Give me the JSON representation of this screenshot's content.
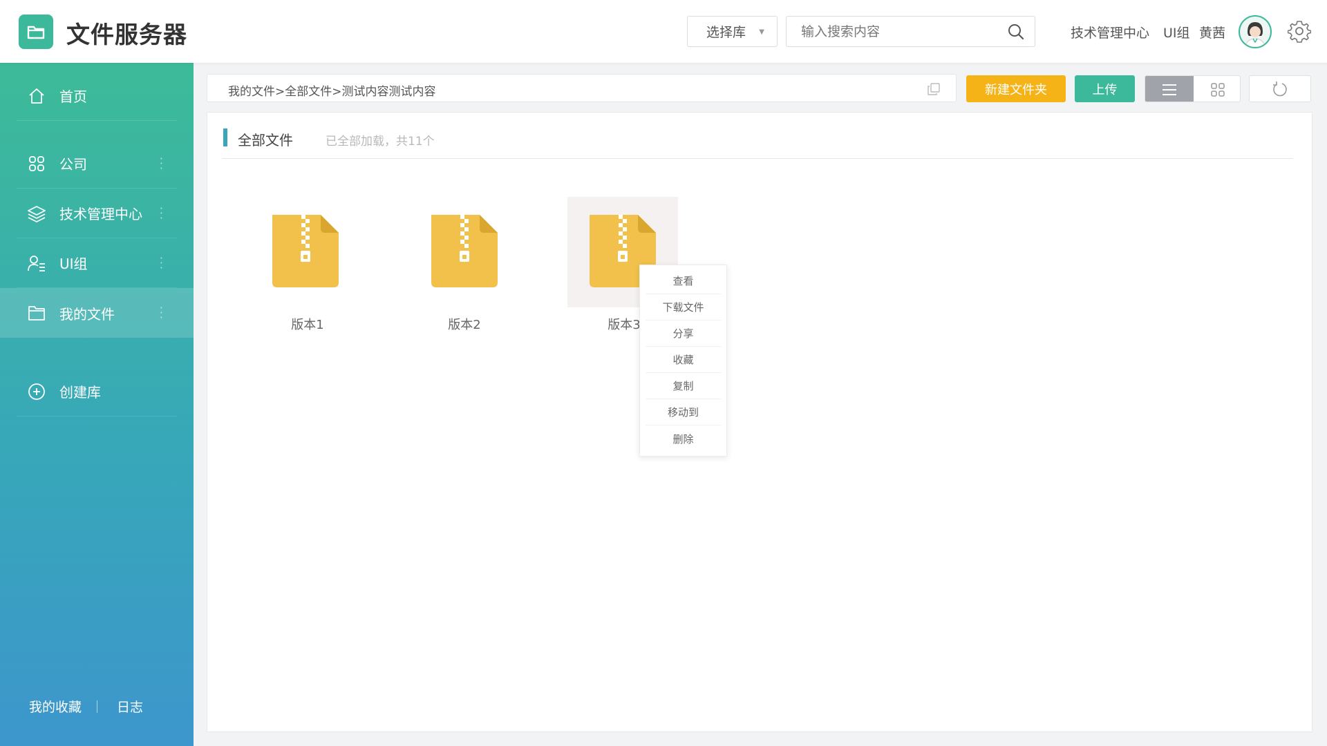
{
  "app": {
    "title": "文件服务器"
  },
  "header": {
    "library_select": "选择库",
    "search_placeholder": "输入搜索内容",
    "user_dept": "技术管理中心",
    "user_group": "UI组",
    "user_name": "黄茜"
  },
  "sidebar": {
    "items": [
      {
        "label": "首页",
        "icon": "home-icon"
      },
      {
        "label": "公司",
        "icon": "grid-icon"
      },
      {
        "label": "技术管理中心",
        "icon": "layers-icon"
      },
      {
        "label": "UI组",
        "icon": "user-group-icon"
      },
      {
        "label": "我的文件",
        "icon": "folder-icon",
        "active": true
      },
      {
        "label": "创建库",
        "icon": "plus-circle-icon"
      }
    ],
    "bottom_links": [
      "我的收藏",
      "日志"
    ]
  },
  "toolbar": {
    "breadcrumb": "我的文件>全部文件>测试内容测试内容",
    "new_folder": "新建文件夹",
    "upload": "上传"
  },
  "panel": {
    "title": "全部文件",
    "subtitle": "已全部加载，共11个"
  },
  "files": [
    {
      "name": "版本1",
      "icon": "zip-file-icon"
    },
    {
      "name": "版本2",
      "icon": "zip-file-icon"
    },
    {
      "name": "版本3",
      "icon": "zip-file-icon",
      "selected": true
    }
  ],
  "context_menu": [
    "查看",
    "下载文件",
    "分享",
    "收藏",
    "复制",
    "移动到",
    "删除"
  ],
  "colors": {
    "brand": "#3cb99a",
    "accent_orange": "#f6b317",
    "file_yellow": "#f2c14b"
  }
}
